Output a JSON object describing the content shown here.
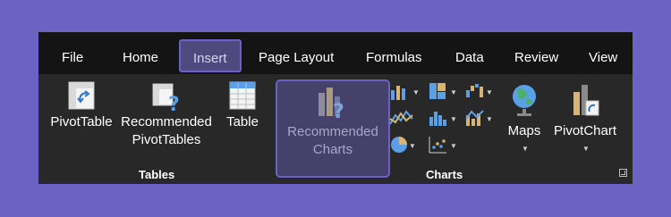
{
  "tabs": [
    "File",
    "Home",
    "Insert",
    "Page Layout",
    "Formulas",
    "Data",
    "Review",
    "View"
  ],
  "active_tab": "Insert",
  "commands": {
    "pivottable": "PivotTable",
    "recommended_pivottables_line1": "Recommended",
    "recommended_pivottables_line2": "PivotTables",
    "table": "Table",
    "recommended_charts_line1": "Recommended",
    "recommended_charts_line2": "Charts",
    "maps": "Maps",
    "pivotchart": "PivotChart"
  },
  "groups": {
    "tables": "Tables",
    "charts": "Charts"
  },
  "colors": {
    "accent": "#6b62c3",
    "selected_bg": "#45416a",
    "blue": "#5aa0e6",
    "tan": "#d6b476",
    "ribbon_bg": "#282828",
    "tabbar_bg": "#141414"
  },
  "icons": {
    "pivottable": "pivot-table-icon",
    "recommended_pivottables": "recommended-pivottables-icon",
    "table": "table-icon",
    "recommended_charts": "recommended-charts-icon",
    "maps": "globe-icon",
    "pivotchart": "pivot-chart-icon"
  }
}
